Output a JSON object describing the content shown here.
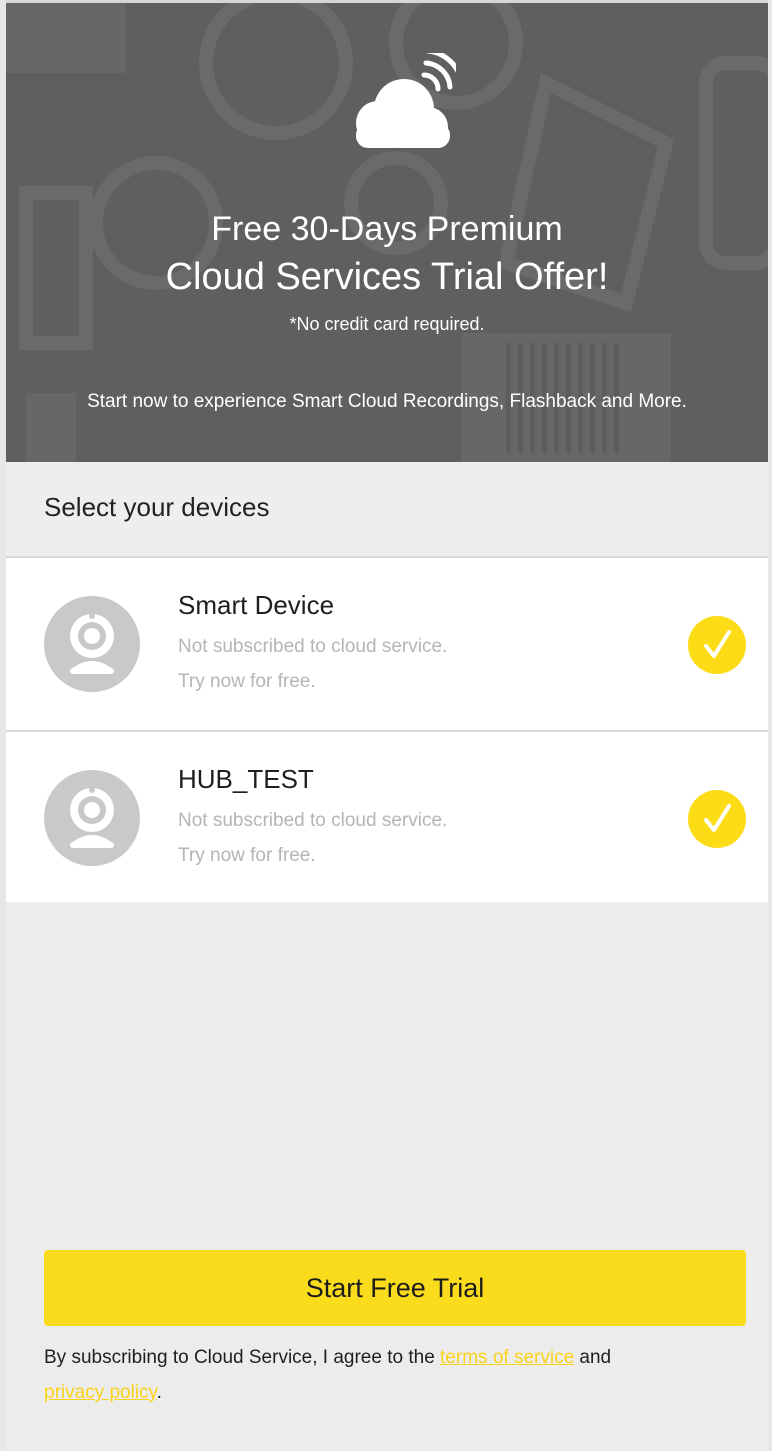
{
  "hero": {
    "title_line1": "Free 30-Days Premium",
    "title_line2": "Cloud Services Trial Offer!",
    "note": "*No credit card required.",
    "description": "Start now to experience Smart Cloud Recordings, Flashback and More."
  },
  "section": {
    "title": "Select your devices"
  },
  "devices": [
    {
      "name": "Smart Device",
      "status": "Not subscribed to cloud service.",
      "hint": "Try now for free.",
      "selected": true
    },
    {
      "name": "HUB_TEST",
      "status": "Not subscribed to cloud service.",
      "hint": "Try now for free.",
      "selected": true
    }
  ],
  "button": {
    "label": "Start Free Trial"
  },
  "terms": {
    "prefix": "By subscribing to Cloud Service, I agree to the ",
    "terms_link": "terms of service",
    "middle": " and",
    "privacy_link": "privacy policy",
    "suffix": "."
  },
  "colors": {
    "accent": "#fbdc1c",
    "hero_bg": "#5f5f5f",
    "muted_text": "#b5b5b5"
  },
  "icons": {
    "hero": "cloud-wifi-icon",
    "device": "webcam-icon",
    "selected": "check-circle-icon"
  }
}
